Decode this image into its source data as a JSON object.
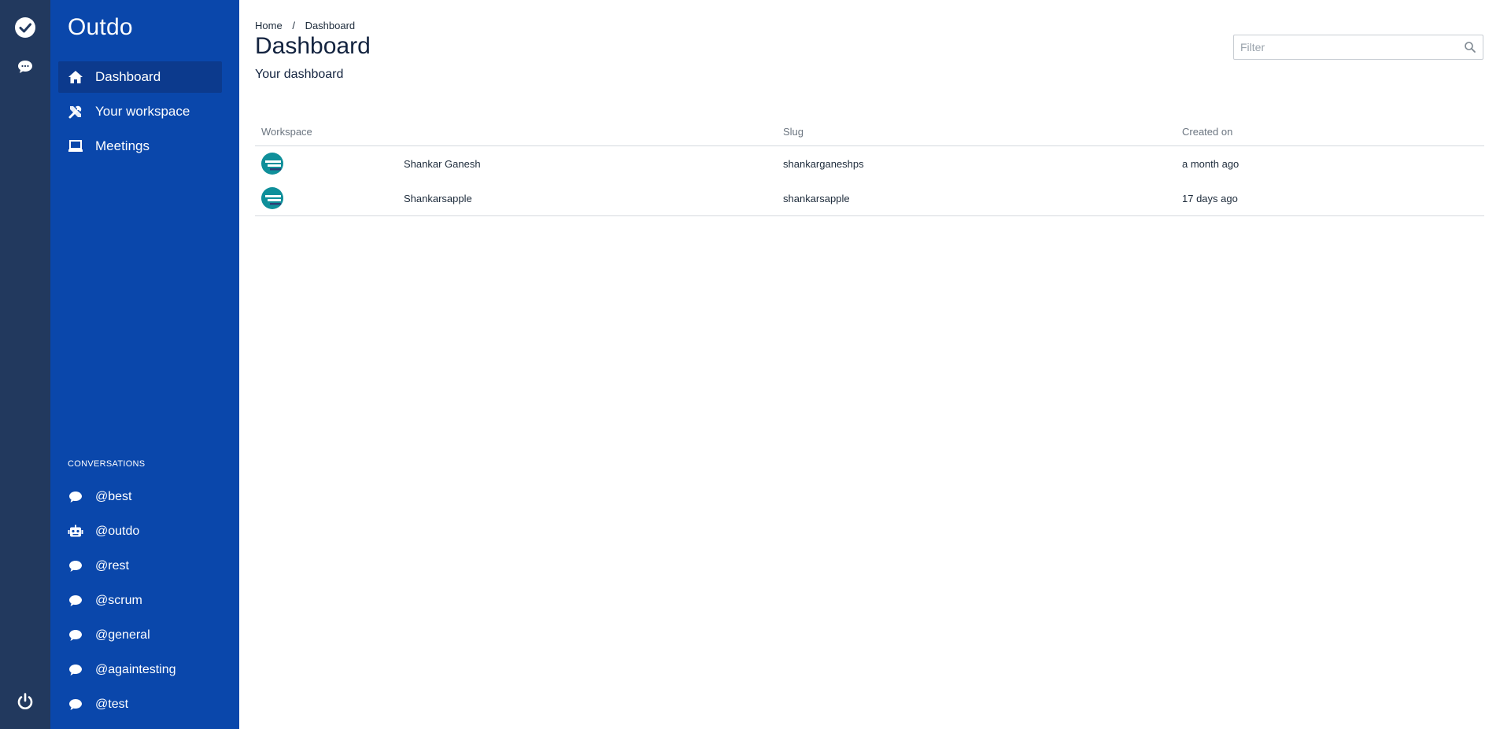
{
  "app": {
    "name": "Outdo"
  },
  "rail": {
    "logo_icon": "check-circle-icon",
    "chat_icon": "chat-bubble-icon",
    "power_icon": "power-icon"
  },
  "sidebar": {
    "brand": "Outdo",
    "nav": [
      {
        "label": "Dashboard",
        "icon": "home-icon",
        "active": true
      },
      {
        "label": "Your workspace",
        "icon": "tools-icon"
      },
      {
        "label": "Meetings",
        "icon": "laptop-icon"
      }
    ],
    "conversations_title": "CONVERSATIONS",
    "conversations": [
      {
        "label": "@best",
        "icon": "chat-bubble-icon"
      },
      {
        "label": "@outdo",
        "icon": "robot-icon"
      },
      {
        "label": "@rest",
        "icon": "chat-bubble-icon"
      },
      {
        "label": "@scrum",
        "icon": "chat-bubble-icon"
      },
      {
        "label": "@general",
        "icon": "chat-bubble-icon"
      },
      {
        "label": "@againtesting",
        "icon": "chat-bubble-icon"
      },
      {
        "label": "@test",
        "icon": "chat-bubble-icon"
      }
    ]
  },
  "main": {
    "breadcrumb": [
      "Home",
      "Dashboard"
    ],
    "title": "Dashboard",
    "subtitle": "Your dashboard",
    "filter": {
      "placeholder": "Filter",
      "value": ""
    },
    "table": {
      "columns": [
        "Workspace",
        "Slug",
        "Created on"
      ],
      "rows": [
        {
          "name": "Shankar Ganesh",
          "slug": "shankarganeshps",
          "created": "a month ago"
        },
        {
          "name": "Shankarsapple",
          "slug": "shankarsapple",
          "created": "17 days ago"
        }
      ]
    }
  },
  "colors": {
    "rail": "#22395e",
    "sidebar": "#0a47ab",
    "sidebar_active": "#0c3a8d",
    "avatar": "#0f8f9a"
  }
}
